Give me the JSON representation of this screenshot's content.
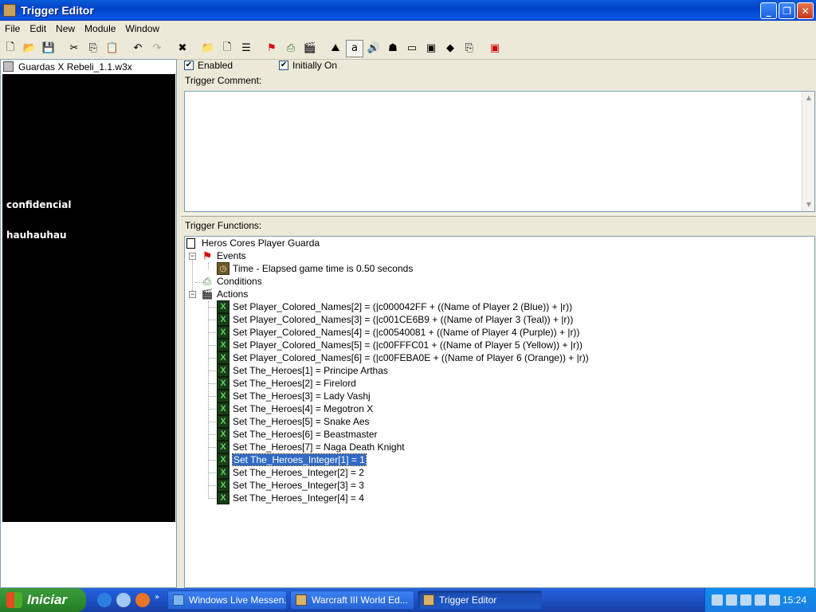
{
  "window": {
    "title": "Trigger Editor",
    "minimize": "_",
    "maximize": "❐",
    "close": "✕"
  },
  "menu": [
    "File",
    "Edit",
    "New",
    "Module",
    "Window"
  ],
  "left_panel": {
    "map_name": "Guardas X Rebeli_1.1.w3x",
    "text1": "confidencial",
    "text2": "hauhauhau"
  },
  "trigger": {
    "enabled_label": "Enabled",
    "enabled": true,
    "initially_on_label": "Initially On",
    "initially_on": true,
    "comment_label": "Trigger Comment:",
    "comment": "",
    "functions_label": "Trigger Functions:",
    "name": "Heros Cores Player Guarda",
    "events_label": "Events",
    "event": "Time - Elapsed game time is 0.50 seconds",
    "conditions_label": "Conditions",
    "actions_label": "Actions",
    "actions": [
      "Set Player_Colored_Names[2] = (|c000042FF + ((Name of Player 2 (Blue)) + |r))",
      "Set Player_Colored_Names[3] = (|c001CE6B9 + ((Name of Player 3 (Teal)) + |r))",
      "Set Player_Colored_Names[4] = (|c00540081 + ((Name of Player 4 (Purple)) + |r))",
      "Set Player_Colored_Names[5] = (|c00FFFC01 + ((Name of Player 5 (Yellow)) + |r))",
      "Set Player_Colored_Names[6] = (|c00FEBA0E + ((Name of Player 6 (Orange)) + |r))",
      "Set The_Heroes[1] = Principe Arthas",
      "Set The_Heroes[2] = Firelord",
      "Set The_Heroes[3] = Lady Vashj",
      "Set The_Heroes[4] = Megotron X",
      "Set The_Heroes[5] = Snake Aes",
      "Set The_Heroes[6] = Beastmaster",
      "Set The_Heroes[7] = Naga Death Knight",
      "Set The_Heroes_Integer[1] = 1",
      "Set The_Heroes_Integer[2] = 2",
      "Set The_Heroes_Integer[3] = 3",
      "Set The_Heroes_Integer[4] = 4"
    ],
    "selected_action_index": 12
  },
  "taskbar": {
    "start_label": "Iniciar",
    "tasks": [
      "Windows Live Messen...",
      "Warcraft III World Ed...",
      "Trigger Editor"
    ],
    "active_task_index": 2,
    "clock": "15:24"
  },
  "colors": {
    "title_bar": "#0a5bd8",
    "selection": "#316ac5",
    "taskbar": "#245edb",
    "start_button": "#2f8f2f"
  }
}
